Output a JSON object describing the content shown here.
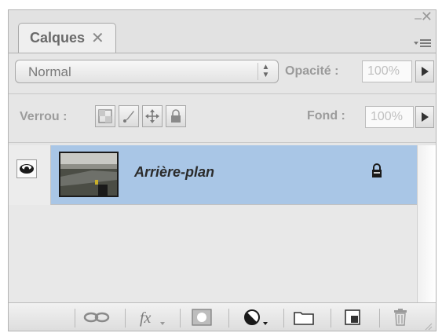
{
  "panel": {
    "tab_label": "Calques",
    "tab_close": "✕",
    "collapse_glyph": "–",
    "close_glyph": "✕"
  },
  "blend": {
    "mode": "Normal",
    "opacity_label": "Opacité :",
    "opacity_value": "100%"
  },
  "lock": {
    "label": "Verrou :",
    "fill_label": "Fond :",
    "fill_value": "100%"
  },
  "layers": [
    {
      "name": "Arrière-plan",
      "visible": true,
      "locked": true
    }
  ],
  "colors": {
    "selected_row": "#a9c6e6",
    "panel_bg": "#e6e6e6"
  },
  "icons": {
    "tab": [
      "close-tab-icon"
    ],
    "header": [
      "collapse-icon",
      "close-panel-icon",
      "panel-menu-icon"
    ],
    "lock_buttons": [
      "lock-transparent-pixels-icon",
      "lock-image-pixels-icon",
      "lock-position-icon",
      "lock-all-icon"
    ],
    "bottom_bar": [
      "link-layers-icon",
      "layer-style-fx-icon",
      "add-mask-icon",
      "adjustment-layer-icon",
      "new-group-icon",
      "new-layer-icon",
      "delete-layer-icon"
    ]
  }
}
